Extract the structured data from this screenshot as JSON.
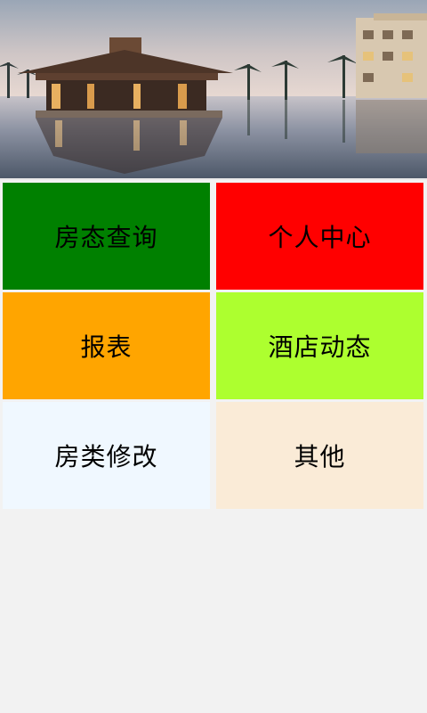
{
  "banner": {
    "image": "hotel-resort-photo"
  },
  "menu": {
    "tiles": [
      {
        "label": "房态查询",
        "color": "#008000"
      },
      {
        "label": "个人中心",
        "color": "#ff0000"
      },
      {
        "label": "报表",
        "color": "#ffa500"
      },
      {
        "label": "酒店动态",
        "color": "#adff2f"
      },
      {
        "label": "房类修改",
        "color": "#f0f8ff"
      },
      {
        "label": "其他",
        "color": "#faebd7"
      }
    ]
  },
  "colors": {
    "background": "#f2f2f2",
    "text": "#000000"
  }
}
